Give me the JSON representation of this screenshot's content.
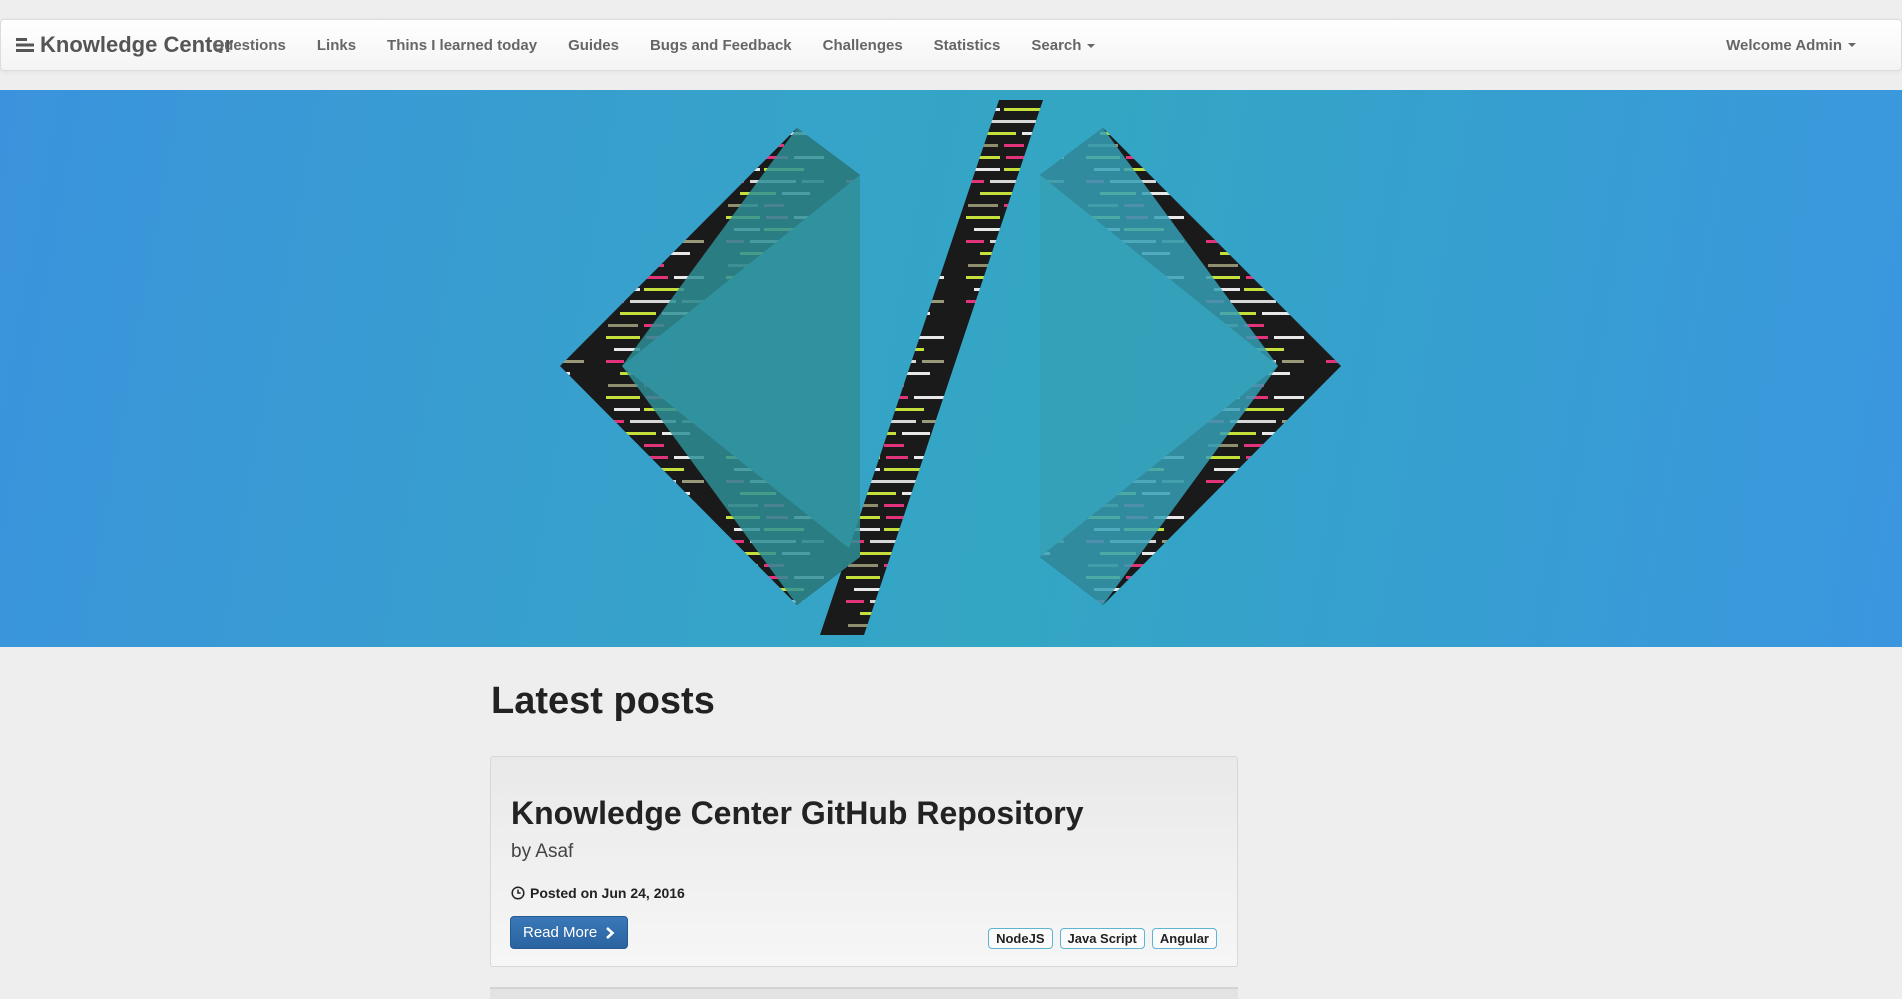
{
  "navbar": {
    "brand": "Knowledge Center",
    "items": [
      {
        "label": "Questions"
      },
      {
        "label": "Links"
      },
      {
        "label": "Thins I learned today"
      },
      {
        "label": "Guides"
      },
      {
        "label": "Bugs and Feedback"
      },
      {
        "label": "Challenges"
      },
      {
        "label": "Statistics"
      },
      {
        "label": "Search"
      }
    ],
    "user_menu": "Welcome Admin"
  },
  "main": {
    "heading": "Latest posts",
    "posts": [
      {
        "title": "Knowledge Center GitHub Repository",
        "author": "by Asaf",
        "date": "Posted on Jun 24, 2016",
        "read_more": "Read More",
        "tags": [
          "NodeJS",
          "Java Script",
          "Angular"
        ]
      }
    ]
  },
  "colors": {
    "hero": "#36a3c9",
    "button": "#2f6dad",
    "tag_border": "#5fb3d3"
  },
  "icons": {
    "brand": "bars-icon",
    "date": "clock-icon",
    "read_more": "chevron-right-icon"
  }
}
